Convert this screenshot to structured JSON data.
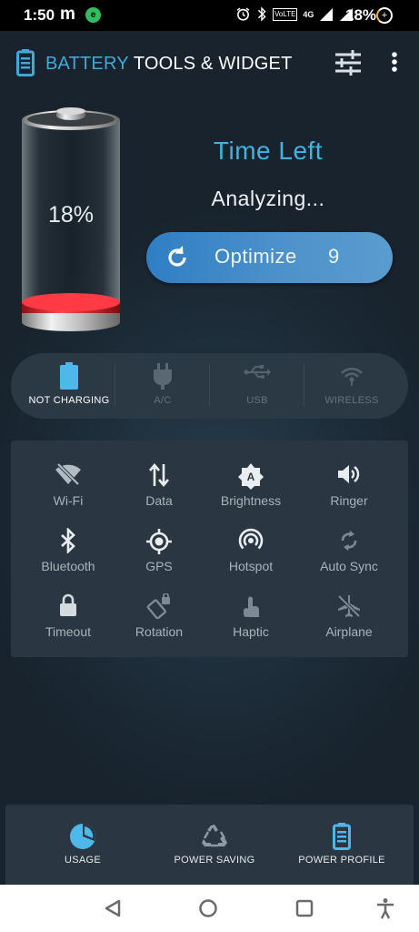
{
  "status_bar": {
    "time": "1:50",
    "carrier_icon": "m",
    "notification_badge": "e",
    "sim_label": "VoLTE",
    "network": "4G",
    "battery_percent": "18%"
  },
  "app_bar": {
    "title_part1": "BATTERY",
    "title_part2": "TOOLS & WIDGET"
  },
  "battery": {
    "percent": "18%",
    "level": 0.18
  },
  "status": {
    "time_left_label": "Time Left",
    "time_left_value": "Analyzing..."
  },
  "optimize": {
    "label": "Optimize",
    "count": "9"
  },
  "charging": [
    {
      "label": "NOT CHARGING",
      "icon": "battery-icon",
      "active": true
    },
    {
      "label": "A/C",
      "icon": "plug-icon",
      "active": false
    },
    {
      "label": "USB",
      "icon": "usb-icon",
      "active": false
    },
    {
      "label": "WIRELESS",
      "icon": "wireless-icon",
      "active": false
    }
  ],
  "toggles": [
    {
      "label": "Wi-Fi",
      "icon": "wifi-off-icon"
    },
    {
      "label": "Data",
      "icon": "data-icon"
    },
    {
      "label": "Brightness",
      "icon": "brightness-auto-icon"
    },
    {
      "label": "Ringer",
      "icon": "speaker-icon"
    },
    {
      "label": "Bluetooth",
      "icon": "bluetooth-icon"
    },
    {
      "label": "GPS",
      "icon": "gps-icon"
    },
    {
      "label": "Hotspot",
      "icon": "hotspot-icon"
    },
    {
      "label": "Auto Sync",
      "icon": "sync-icon"
    },
    {
      "label": "Timeout",
      "icon": "lock-icon"
    },
    {
      "label": "Rotation",
      "icon": "rotation-icon"
    },
    {
      "label": "Haptic",
      "icon": "touch-icon"
    },
    {
      "label": "Airplane",
      "icon": "airplane-off-icon"
    }
  ],
  "bottom_nav": [
    {
      "label": "USAGE",
      "icon": "pie-chart-icon"
    },
    {
      "label": "POWER SAVING",
      "icon": "recycle-icon"
    },
    {
      "label": "POWER PROFILE",
      "icon": "battery-profile-icon"
    }
  ],
  "colors": {
    "accent": "#46b1de",
    "battery_fill": "#e0303a",
    "button": "#3d88c8"
  }
}
